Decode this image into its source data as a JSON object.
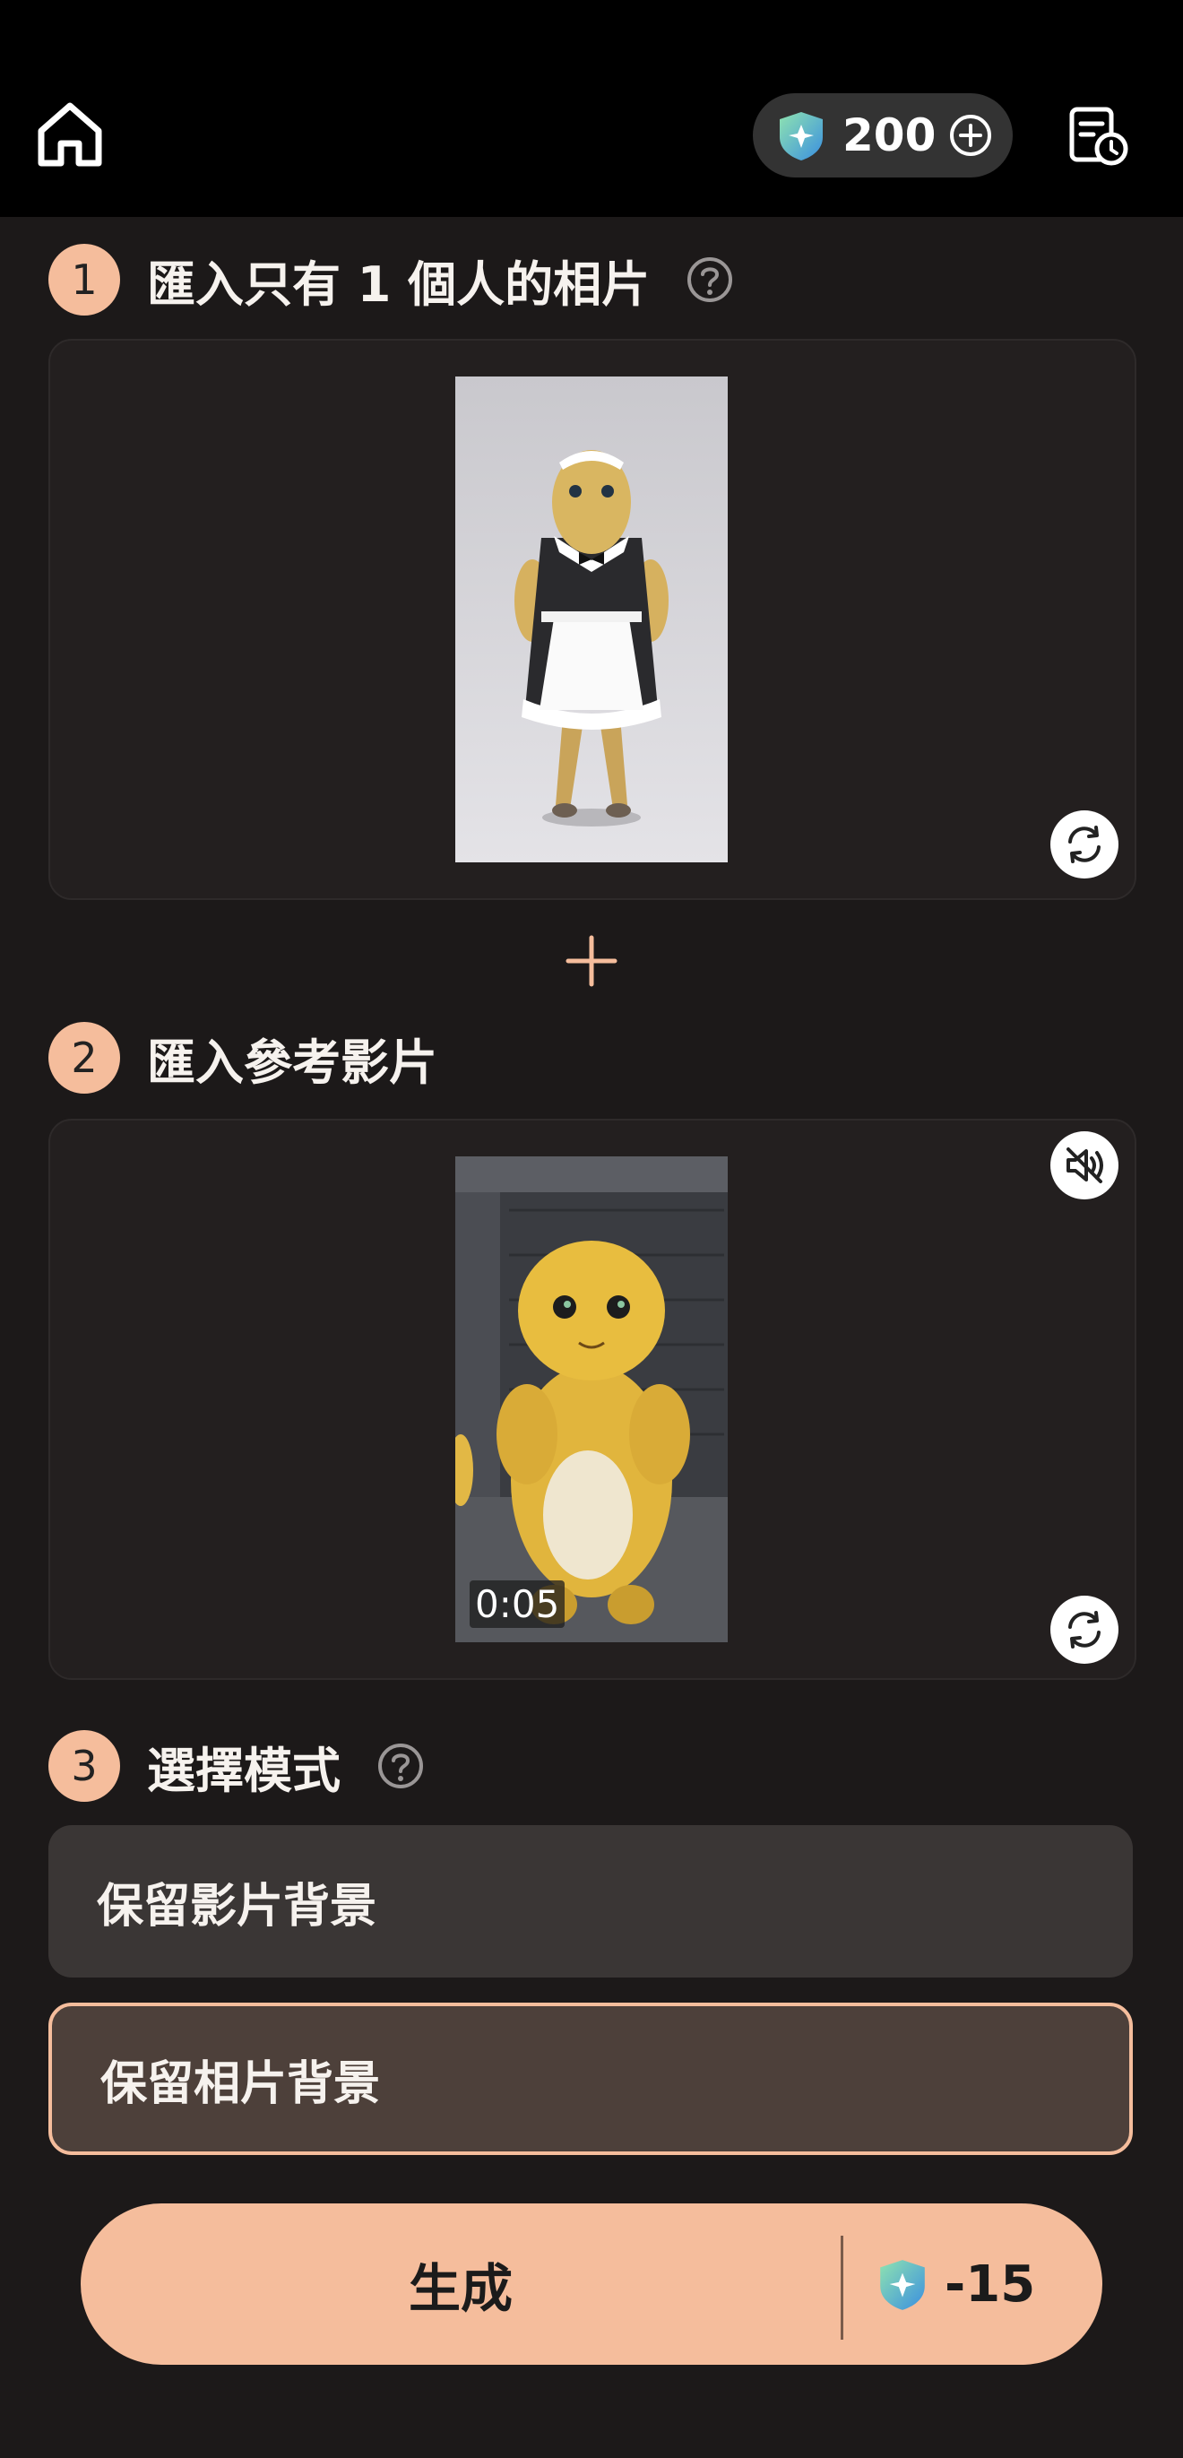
{
  "header": {
    "credits": "200"
  },
  "steps": [
    {
      "number": "1",
      "title": "匯入只有 1 個人的相片"
    },
    {
      "number": "2",
      "title": "匯入參考影片"
    },
    {
      "number": "3",
      "title": "選擇模式"
    }
  ],
  "video": {
    "duration": "0:05"
  },
  "modes": [
    {
      "label": "保留影片背景",
      "selected": false
    },
    {
      "label": "保留相片背景",
      "selected": true
    }
  ],
  "generate": {
    "label": "生成",
    "cost": "-15"
  },
  "icons": {
    "home": "home-icon",
    "credits": "gem-icon",
    "add_credits": "plus-circle-icon",
    "history": "history-icon",
    "help": "help-icon",
    "replace": "refresh-icon",
    "mute": "mute-icon",
    "add": "plus-icon"
  },
  "colors": {
    "accent": "#f5bd9c",
    "background": "#1c1919",
    "card": "#231f1f",
    "selected_mode": "#4d403a"
  }
}
